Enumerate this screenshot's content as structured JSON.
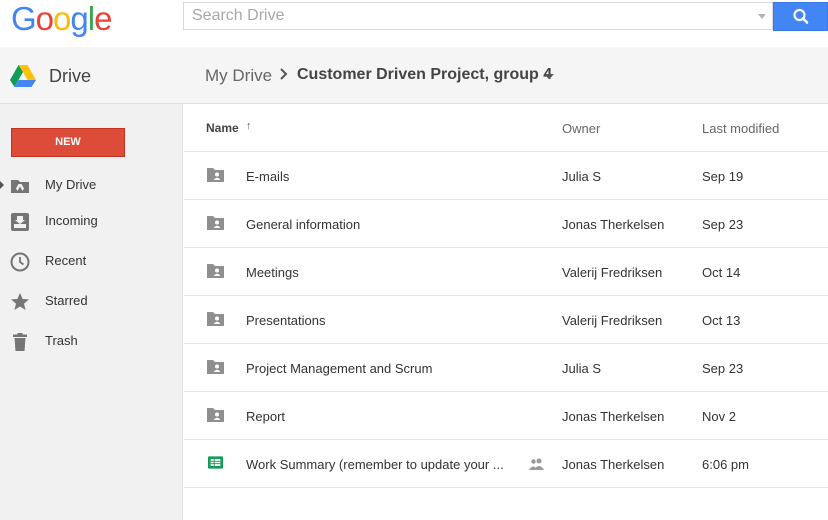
{
  "brand": {
    "logo_letters": [
      "G",
      "o",
      "o",
      "g",
      "l",
      "e"
    ],
    "logo_colors": [
      "#4285f4",
      "#ea4335",
      "#fbbc05",
      "#4285f4",
      "#34a853",
      "#ea4335"
    ]
  },
  "search": {
    "placeholder": "Search Drive",
    "button_icon": "search-icon"
  },
  "app": {
    "title": "Drive",
    "icon": "drive-logo-icon"
  },
  "breadcrumb": {
    "root": "My Drive",
    "current": "Customer Driven Project, group 4"
  },
  "sidebar": {
    "new_label": "NEW",
    "items": [
      {
        "label": "My Drive",
        "icon": "my-drive-icon"
      },
      {
        "label": "Incoming",
        "icon": "incoming-icon"
      },
      {
        "label": "Recent",
        "icon": "clock-icon"
      },
      {
        "label": "Starred",
        "icon": "star-icon"
      },
      {
        "label": "Trash",
        "icon": "trash-icon"
      }
    ]
  },
  "list": {
    "headers": {
      "name": "Name",
      "sort": "↑",
      "owner": "Owner",
      "modified": "Last modified"
    },
    "rows": [
      {
        "name": "E-mails",
        "owner": "Julia S",
        "modified": "Sep 19",
        "type": "shared-folder"
      },
      {
        "name": "General information",
        "owner": "Jonas Therkelsen",
        "modified": "Sep 23",
        "type": "shared-folder"
      },
      {
        "name": "Meetings",
        "owner": "Valerij Fredriksen",
        "modified": "Oct 14",
        "type": "shared-folder"
      },
      {
        "name": "Presentations",
        "owner": "Valerij Fredriksen",
        "modified": "Oct 13",
        "type": "shared-folder"
      },
      {
        "name": "Project Management and Scrum",
        "owner": "Julia S",
        "modified": "Sep 23",
        "type": "shared-folder"
      },
      {
        "name": "Report",
        "owner": "Jonas Therkelsen",
        "modified": "Nov 2",
        "type": "shared-folder"
      },
      {
        "name": "Work Summary (remember to update your ...",
        "owner": "Jonas Therkelsen",
        "modified": "6:06 pm",
        "type": "spreadsheet",
        "shared": true
      }
    ]
  },
  "colors": {
    "accent_blue": "#4285f4",
    "new_red": "#dd4b39",
    "sheet_green": "#0f9d58"
  }
}
